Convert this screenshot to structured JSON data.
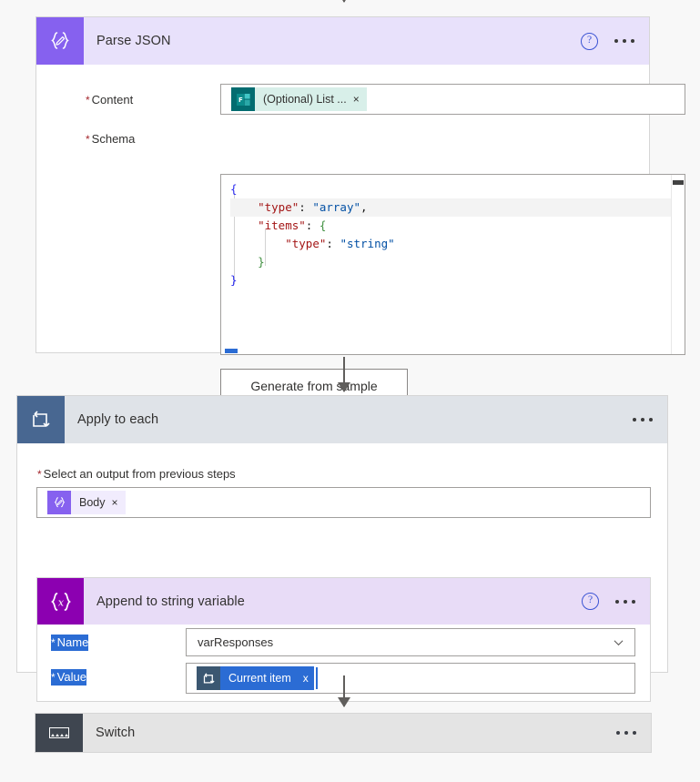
{
  "flow": {
    "cards": [
      {
        "id": "parse-json",
        "title": "Parse JSON",
        "icon": "braces-json-icon",
        "help_label": "?",
        "fields": {
          "content": {
            "label": "Content",
            "required_marker": "*",
            "token": {
              "label": "(Optional) List ...",
              "icon": "microsoft-forms-icon",
              "remove": "×"
            }
          },
          "schema": {
            "label": "Schema",
            "required_marker": "*",
            "code_lines": [
              {
                "indent": 0,
                "segments": [
                  {
                    "cls": "k-brace",
                    "text": "{"
                  }
                ]
              },
              {
                "indent": 1,
                "active": true,
                "segments": [
                  {
                    "cls": "k-key",
                    "text": "\"type\""
                  },
                  {
                    "cls": "k-punct",
                    "text": ": "
                  },
                  {
                    "cls": "k-str",
                    "text": "\"array\""
                  },
                  {
                    "cls": "k-punct",
                    "text": ","
                  }
                ]
              },
              {
                "indent": 1,
                "segments": [
                  {
                    "cls": "k-key",
                    "text": "\"items\""
                  },
                  {
                    "cls": "k-punct",
                    "text": ": "
                  },
                  {
                    "cls": "k-brace-g",
                    "text": "{"
                  }
                ]
              },
              {
                "indent": 2,
                "segments": [
                  {
                    "cls": "k-key",
                    "text": "\"type\""
                  },
                  {
                    "cls": "k-punct",
                    "text": ": "
                  },
                  {
                    "cls": "k-str",
                    "text": "\"string\""
                  }
                ]
              },
              {
                "indent": 1,
                "segments": [
                  {
                    "cls": "k-brace-g",
                    "text": "}"
                  }
                ]
              },
              {
                "indent": 0,
                "segments": [
                  {
                    "cls": "k-brace",
                    "text": "}"
                  }
                ]
              }
            ]
          }
        },
        "generate_button": "Generate from sample"
      },
      {
        "id": "apply-each",
        "title": "Apply to each",
        "icon": "loop-foreach-icon",
        "fields": {
          "output_select": {
            "label": "Select an output from previous steps",
            "required_marker": "*",
            "token": {
              "label": "Body",
              "icon": "braces-json-icon",
              "remove": "×"
            }
          }
        }
      },
      {
        "id": "append-card",
        "title": "Append to string variable",
        "icon": "variable-braces-x-icon",
        "help_label": "?",
        "fields": {
          "name": {
            "label": "Name",
            "required_marker": "*",
            "selected": true,
            "value": "varResponses",
            "control": "dropdown"
          },
          "value": {
            "label": "Value",
            "required_marker": "*",
            "selected": true,
            "token": {
              "label": "Current item",
              "icon": "loop-foreach-icon",
              "remove": "x",
              "selected": true
            }
          }
        }
      },
      {
        "id": "switch-card",
        "title": "Switch",
        "icon": "switch-case-icon"
      }
    ],
    "colors": {
      "parse_json_header": "#e8e1fb",
      "parse_json_icon": "#8661ef",
      "apply_each_header": "#dfe3e8",
      "apply_each_icon": "#486791",
      "append_header": "#e8dcf7",
      "append_icon": "#8c00b1",
      "switch_header": "#e4e4e4",
      "switch_icon": "#3f4650",
      "forms_token_bg": "#d8efe9",
      "forms_token_icon": "#036c70",
      "selection_blue": "#2b6cd4",
      "required_red": "#a4262c",
      "help_blue": "#3b54d4",
      "connector": "#605e5c"
    }
  }
}
